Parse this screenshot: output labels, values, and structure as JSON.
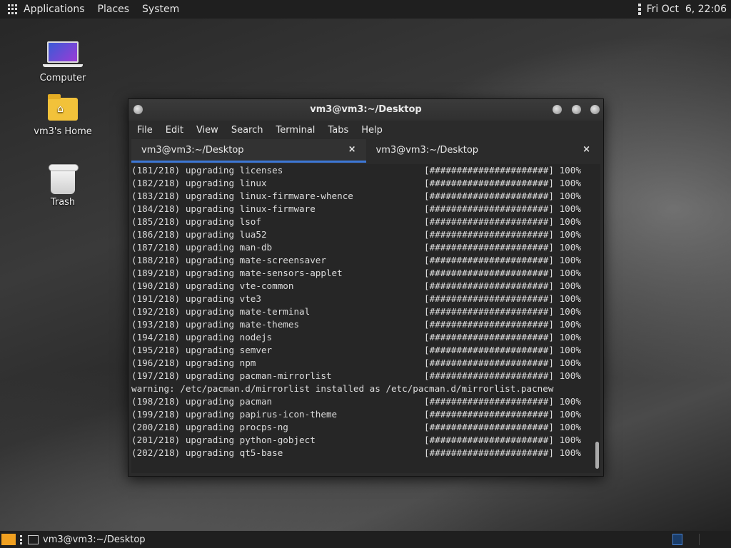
{
  "top_panel": {
    "menu": [
      "Applications",
      "Places",
      "System"
    ],
    "clock": "Fri Oct  6, 22:06"
  },
  "desktop_icons": [
    {
      "label": "Computer",
      "icon": "computer-icon"
    },
    {
      "label": "vm3's Home",
      "icon": "home-folder-icon"
    },
    {
      "label": "Trash",
      "icon": "trash-icon"
    }
  ],
  "terminal": {
    "title": "vm3@vm3:~/Desktop",
    "menu": [
      "File",
      "Edit",
      "View",
      "Search",
      "Terminal",
      "Tabs",
      "Help"
    ],
    "tabs": [
      {
        "label": "vm3@vm3:~/Desktop",
        "close": "×"
      },
      {
        "label": "vm3@vm3:~/Desktop",
        "close": "×"
      }
    ],
    "progress_bar": "[######################]",
    "lines": [
      {
        "text": "(181/218) upgrading licenses",
        "pct": "100%"
      },
      {
        "text": "(182/218) upgrading linux",
        "pct": "100%"
      },
      {
        "text": "(183/218) upgrading linux-firmware-whence",
        "pct": "100%"
      },
      {
        "text": "(184/218) upgrading linux-firmware",
        "pct": "100%"
      },
      {
        "text": "(185/218) upgrading lsof",
        "pct": "100%"
      },
      {
        "text": "(186/218) upgrading lua52",
        "pct": "100%"
      },
      {
        "text": "(187/218) upgrading man-db",
        "pct": "100%"
      },
      {
        "text": "(188/218) upgrading mate-screensaver",
        "pct": "100%"
      },
      {
        "text": "(189/218) upgrading mate-sensors-applet",
        "pct": "100%"
      },
      {
        "text": "(190/218) upgrading vte-common",
        "pct": "100%"
      },
      {
        "text": "(191/218) upgrading vte3",
        "pct": "100%"
      },
      {
        "text": "(192/218) upgrading mate-terminal",
        "pct": "100%"
      },
      {
        "text": "(193/218) upgrading mate-themes",
        "pct": "100%"
      },
      {
        "text": "(194/218) upgrading nodejs",
        "pct": "100%"
      },
      {
        "text": "(195/218) upgrading semver",
        "pct": "100%"
      },
      {
        "text": "(196/218) upgrading npm",
        "pct": "100%"
      },
      {
        "text": "(197/218) upgrading pacman-mirrorlist",
        "pct": "100%"
      },
      {
        "text": "warning: /etc/pacman.d/mirrorlist installed as /etc/pacman.d/mirrorlist.pacnew",
        "pct": ""
      },
      {
        "text": "(198/218) upgrading pacman",
        "pct": "100%"
      },
      {
        "text": "(199/218) upgrading papirus-icon-theme",
        "pct": "100%"
      },
      {
        "text": "(200/218) upgrading procps-ng",
        "pct": "100%"
      },
      {
        "text": "(201/218) upgrading python-gobject",
        "pct": "100%"
      },
      {
        "text": "(202/218) upgrading qt5-base",
        "pct": "100%"
      }
    ]
  },
  "bottom_panel": {
    "task_label": "vm3@vm3:~/Desktop"
  }
}
